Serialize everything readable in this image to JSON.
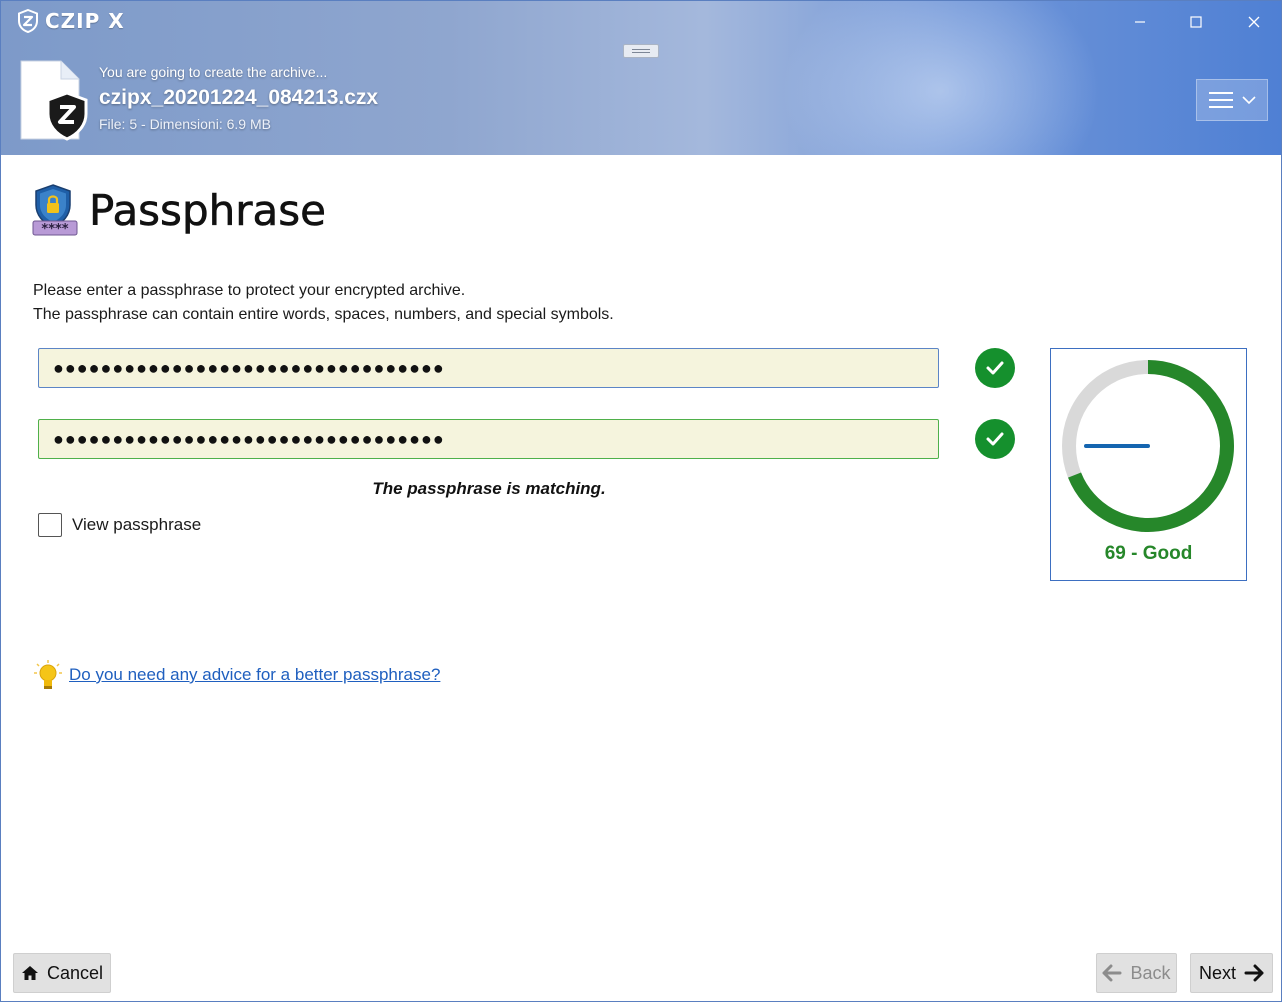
{
  "app": {
    "name": "CZIP X"
  },
  "window_controls": {
    "minimize": "minimize-icon",
    "maximize": "maximize-icon",
    "close": "close-icon"
  },
  "archive": {
    "subtitle": "You are going to create the archive...",
    "filename": "czipx_20201224_084213.czx",
    "meta": "File: 5 - Dimensioni: 6.9 MB"
  },
  "menu": {
    "icon": "hamburger-icon",
    "caret": "chevron-down-icon"
  },
  "page": {
    "title": "Passphrase",
    "desc_line1": "Please enter a passphrase to protect your encrypted archive.",
    "desc_line2": "The passphrase can contain entire words, spaces, numbers, and special symbols."
  },
  "passphrase": {
    "field1_value": "●●●●●●●●●●●●●●●●●●●●●●●●●●●●●●●●●",
    "field2_value": "●●●●●●●●●●●●●●●●●●●●●●●●●●●●●●●●●",
    "match_message": "The passphrase is matching.",
    "view_label": "View passphrase",
    "view_checked": false
  },
  "strength": {
    "score": 69,
    "label": "69 - Good",
    "arc_color": "#26872a",
    "track_color": "#d9d9d9",
    "needle_color": "#1565b0"
  },
  "advice": {
    "link_text": "Do you need any advice for a better passphrase?"
  },
  "buttons": {
    "cancel": "Cancel",
    "back": "Back",
    "next": "Next"
  },
  "colors": {
    "accent": "#3d6fc1",
    "success": "#15902d",
    "link": "#1f5fbf"
  }
}
